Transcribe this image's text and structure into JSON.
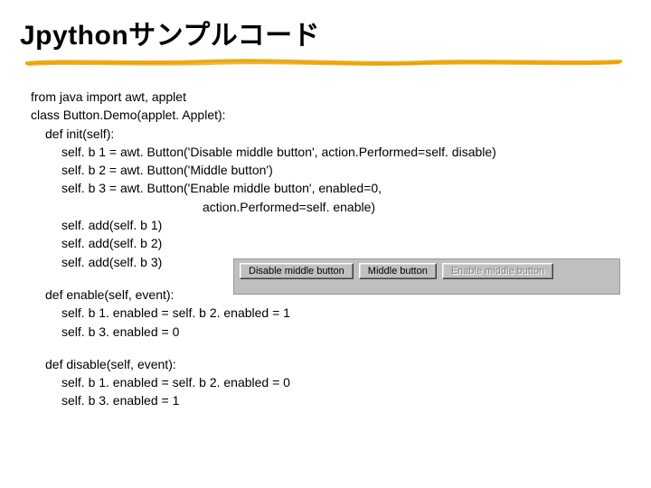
{
  "title": "Jpythonサンプルコード",
  "code": {
    "l1": "from java import awt, applet",
    "l2": "class Button.Demo(applet. Applet):",
    "l3": "def init(self):",
    "l4": "self. b 1 = awt. Button('Disable middle button', action.Performed=self. disable)",
    "l5": "self. b 2 = awt. Button('Middle button')",
    "l6": "self. b 3 = awt. Button('Enable middle button', enabled=0,",
    "l7": "action.Performed=self. enable)",
    "l8": "self. add(self. b 1)",
    "l9": "self. add(self. b 2)",
    "l10": "self. add(self. b 3)",
    "l11": "def enable(self, event):",
    "l12": "self. b 1. enabled = self. b 2. enabled = 1",
    "l13": "self. b 3. enabled = 0",
    "l14": "def disable(self, event):",
    "l15": "self. b 1. enabled = self. b 2. enabled = 0",
    "l16": "self. b 3. enabled = 1"
  },
  "applet": {
    "b1": "Disable middle button",
    "b2": "Middle button",
    "b3": "Enable middle button"
  },
  "colors": {
    "underline": "#f2a900"
  }
}
